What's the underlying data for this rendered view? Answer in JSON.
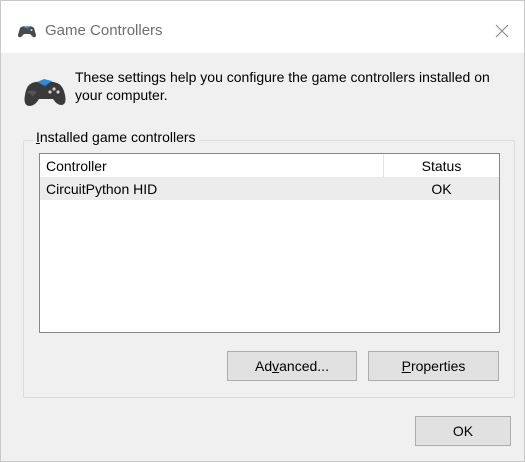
{
  "window": {
    "title": "Game Controllers",
    "title_icon": "gamepad-icon",
    "close_icon": "close-icon"
  },
  "intro": {
    "icon": "gamepad-icon",
    "text": "These settings help you configure the game controllers installed on your computer."
  },
  "group": {
    "label_mnemonic": "I",
    "label_rest": "nstalled game controllers"
  },
  "table": {
    "columns": [
      "Controller",
      "Status"
    ],
    "rows": [
      {
        "controller": "CircuitPython HID",
        "status": "OK"
      }
    ]
  },
  "buttons": {
    "advanced_pre": "Ad",
    "advanced_mnemonic": "v",
    "advanced_post": "anced...",
    "properties_mnemonic": "P",
    "properties_post": "roperties",
    "ok": "OK"
  },
  "colors": {
    "dialog_bg": "#f0f0f0",
    "titlebar_bg": "#ffffff",
    "selected_row_bg": "#ececec",
    "button_bg": "#e1e1e1"
  }
}
